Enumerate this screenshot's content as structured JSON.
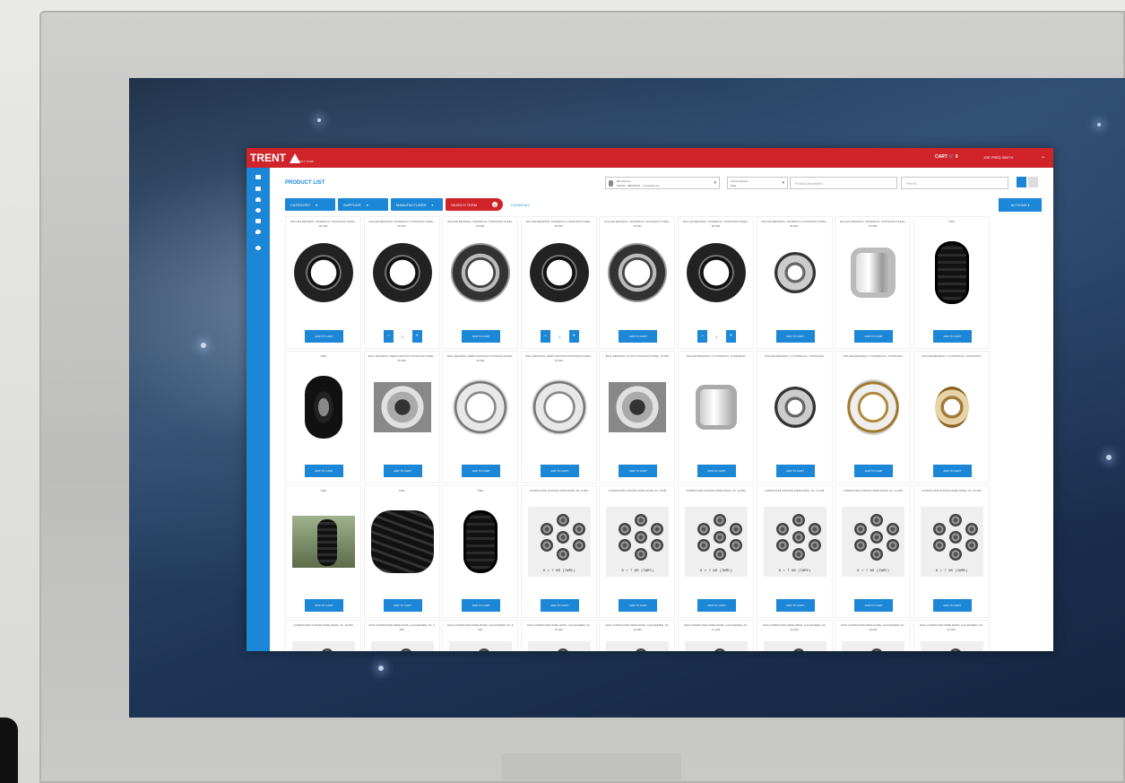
{
  "app": {
    "logo_text": "TRENT",
    "logo_sub": "SUPPLY CORP",
    "cart_label": "CART",
    "cart_count": "0",
    "user_name": "JOE FRED SMITH"
  },
  "sidebar": {
    "icons": [
      "home-icon",
      "box-icon",
      "user-icon",
      "clock-icon",
      "bell-icon",
      "location-icon",
      "gear-icon"
    ]
  },
  "page": {
    "title": "PRODUCT LIST",
    "account_label": "Bill Account",
    "account_value": "SHOW - RBD/HDTL - Industrial, etc.",
    "sort_label": "Sort by Recent",
    "sort_value": "Date",
    "search_placeholder": "Product Description",
    "search2_placeholder": "Part No"
  },
  "filters": {
    "chips": [
      "CATEGORY",
      "SUPPLIER",
      "MANUFACTURER",
      "SEARCH TERM"
    ],
    "clear_label": "CLEAR ALL",
    "actions_label": "ACTIONS"
  },
  "products": {
    "add_label": "ADD TO CART",
    "qty_default": "1",
    "rows": [
      [
        {
          "title": "ROLLER BEARING, SPHERICAL STAINLESS STEEL, 65 MM",
          "image": "bear-dark",
          "mode": "add"
        },
        {
          "title": "ROLLER BEARING, SPHERICAL STAINLESS STEEL, 65 MM",
          "image": "bear-dark",
          "mode": "qty"
        },
        {
          "title": "ROLLER BEARING, SPHERICAL STAINLESS STEEL, 65 MM",
          "image": "bear-metal",
          "mode": "add"
        },
        {
          "title": "ROLLER BEARING, SPHERICAL STAINLESS STEEL, 65 MM",
          "image": "bear-dark",
          "mode": "qty"
        },
        {
          "title": "ROLLER BEARING, SPHERICAL STAINLESS STEEL, 75 MM",
          "image": "bear-metal",
          "mode": "add"
        },
        {
          "title": "ROLLER BEARING, SPHERICAL STAINLESS STEEL, 80 MM",
          "image": "bear-dark",
          "mode": "qty"
        },
        {
          "title": "ROLLER BEARING, SPHERICAL STAINLESS STEEL, 85 MM",
          "image": "bear-small",
          "mode": "add"
        },
        {
          "title": "ROLLER BEARING, SPHERICAL STAINLESS STEEL, 90 MM",
          "image": "bear-tapered",
          "mode": "add"
        },
        {
          "title": "TIRE",
          "image": "tire",
          "mode": "add"
        }
      ],
      [
        {
          "title": "TIRE",
          "image": "tire-side",
          "mode": "add"
        },
        {
          "title": "BALL BEARING, DEEP GROOVE STAINLESS STEEL, 35 MM",
          "image": "bear-photo",
          "mode": "add"
        },
        {
          "title": "BALL BEARING, DEEP GROOVE STAINLESS STEEL, 40 MM",
          "image": "bear-silver",
          "mode": "add"
        },
        {
          "title": "BALL BEARING, DEEP GROOVE STAINLESS STEEL, 45 MM",
          "image": "bear-silver",
          "mode": "add"
        },
        {
          "title": "BALL BEARING, PLAIN STAINLESS STEEL, 50 MM",
          "image": "bear-photo",
          "mode": "add"
        },
        {
          "title": "ROLLER BEARING, CYLINDRICAL, STAINLESS",
          "image": "bear-cyl",
          "mode": "add"
        },
        {
          "title": "ROLLER BEARING, CYLINDRICAL, STAINLESS",
          "image": "bear-small",
          "mode": "add"
        },
        {
          "title": "ROLLER BEARING, CYLINDRICAL, STAINLESS",
          "image": "bear-gold",
          "mode": "add"
        },
        {
          "title": "ROLLER BEARING, CYLINDRICAL, STAINLESS",
          "image": "bear-brass",
          "mode": "add"
        }
      ],
      [
        {
          "title": "TIRE",
          "image": "tire-photo",
          "mode": "add"
        },
        {
          "title": "TIRE",
          "image": "tire-big",
          "mode": "add"
        },
        {
          "title": "TIRE",
          "image": "tire",
          "mode": "add"
        },
        {
          "title": "COMPACTED STRAND WIRE ROPE, 6X, 6 MM",
          "image": "rope",
          "mode": "add"
        },
        {
          "title": "COMPACTED STRAND WIRE ROPE, 6X, 8 MM",
          "image": "rope",
          "mode": "add"
        },
        {
          "title": "COMPACTED STRAND WIRE ROPE, 6X, 10 MM",
          "image": "rope",
          "mode": "add"
        },
        {
          "title": "COMPACTED STRAND WIRE ROPE, 6X, 12 MM",
          "image": "rope",
          "mode": "add"
        },
        {
          "title": "COMPACTED STRAND WIRE ROPE, 6X, 14 MM",
          "image": "rope",
          "mode": "add"
        },
        {
          "title": "COMPACTED STRAND WIRE ROPE, 6X, 16 MM",
          "image": "rope",
          "mode": "add"
        }
      ],
      [
        {
          "title": "COMPACTED STRAND WIRE ROPE, 6X, 18 MM",
          "image": "rope",
          "mode": "add"
        },
        {
          "title": "NON-COMPACTED WIRE ROPE, GALVANIZED, 6X, 6 MM",
          "image": "rope",
          "mode": "add"
        },
        {
          "title": "NON-COMPACTED WIRE ROPE, GALVANIZED, 6X, 8 MM",
          "image": "rope",
          "mode": "add"
        },
        {
          "title": "NON-COMPACTED WIRE ROPE, GALVANIZED, 6X, 10 MM",
          "image": "rope",
          "mode": "add"
        },
        {
          "title": "NON-COMPACTED WIRE ROPE, GALVANIZED, 6X, 12 MM",
          "image": "rope",
          "mode": "add"
        },
        {
          "title": "NON-COMPACTED WIRE ROPE, GALVANIZED, 6X, 14 MM",
          "image": "rope",
          "mode": "add"
        },
        {
          "title": "NON-COMPACTED WIRE ROPE, GALVANIZED, 6X, 16 MM",
          "image": "rope",
          "mode": "add"
        },
        {
          "title": "NON-COMPACTED WIRE ROPE, GALVANIZED, 6X, 18 MM",
          "image": "rope",
          "mode": "add"
        },
        {
          "title": "NON-COMPACTED WIRE ROPE, GALVANIZED, 6X, 20 MM",
          "image": "rope",
          "mode": "add"
        }
      ]
    ],
    "rope_label": "6 × 7 WS (IWRC)"
  },
  "colors": {
    "brand_red": "#d0232a",
    "brand_blue": "#1b87d6"
  }
}
